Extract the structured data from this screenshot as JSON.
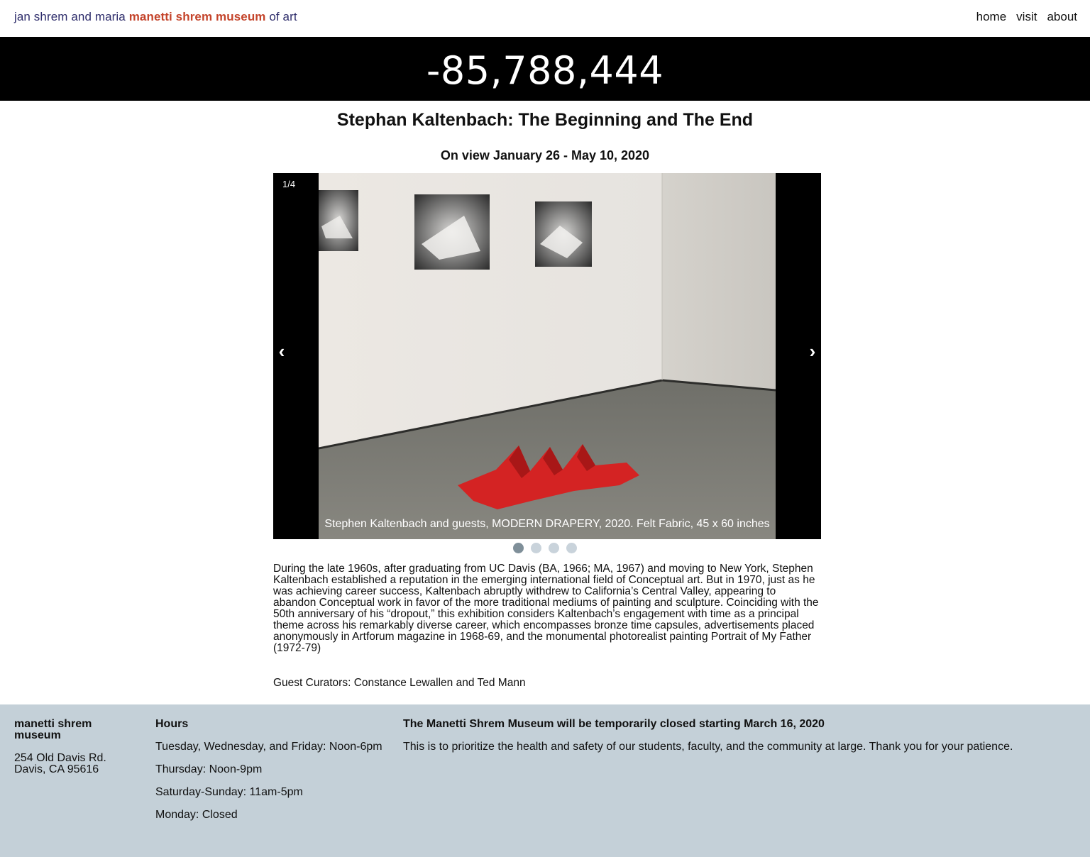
{
  "header": {
    "brand_part1": "jan shrem and maria ",
    "brand_part2": "manetti shrem museum",
    "brand_part3": " of art",
    "nav": [
      "home",
      "visit",
      "about"
    ]
  },
  "counter": "-85,788,444",
  "exhibition": {
    "title": "Stephan Kaltenbach: The Beginning and The End",
    "dates": "On view January 26 - May 10, 2020"
  },
  "slideshow": {
    "position": "1/4",
    "prev_label": "‹",
    "next_label": "›",
    "caption": "Stephen Kaltenbach and guests, MODERN DRAPERY, 2020. Felt Fabric, 45 x 60 inches",
    "total_slides": 4,
    "active_index": 0
  },
  "description": "During the late 1960s, after graduating from UC Davis (BA, 1966; MA, 1967) and moving to New York, Stephen Kaltenbach established a reputation in the emerging international field of Conceptual art. But in 1970, just as he was achieving career success, Kaltenbach abruptly withdrew to California’s Central Valley, appearing to abandon Conceptual work in favor of the more traditional mediums of painting and sculpture. Coinciding with the 50th anniversary of his “dropout,” this exhibition considers Kaltenbach’s engagement with time as a principal theme across his remarkably diverse career, which encompasses bronze time capsules, advertisements placed anonymously in Artforum magazine in 1968-69, and the monumental photorealist painting Portrait of My Father (1972-79)",
  "curators": "Guest Curators: Constance Lewallen and Ted Mann",
  "footer": {
    "museum_name": "manetti shrem museum",
    "address_line1": "254 Old Davis Rd.",
    "address_line2": "Davis, CA 95616",
    "hours_title": "Hours",
    "hours": [
      "Tuesday, Wednesday, and Friday: Noon-6pm",
      "Thursday: Noon-9pm",
      "Saturday-Sunday: 11am-5pm",
      "Monday: Closed"
    ],
    "notice_title": "The Manetti Shrem Museum will be temporarily closed starting March 16, 2020",
    "notice_text": "This is to prioritize the health and safety of our students, faculty, and the community at large. Thank you for your patience."
  },
  "colors": {
    "brand_text": "#2e2d6b",
    "brand_accent": "#c4442b",
    "footer_bg": "#c4d0d8",
    "dot_active": "#7f8f99",
    "dot_inactive": "#c9d3db"
  }
}
